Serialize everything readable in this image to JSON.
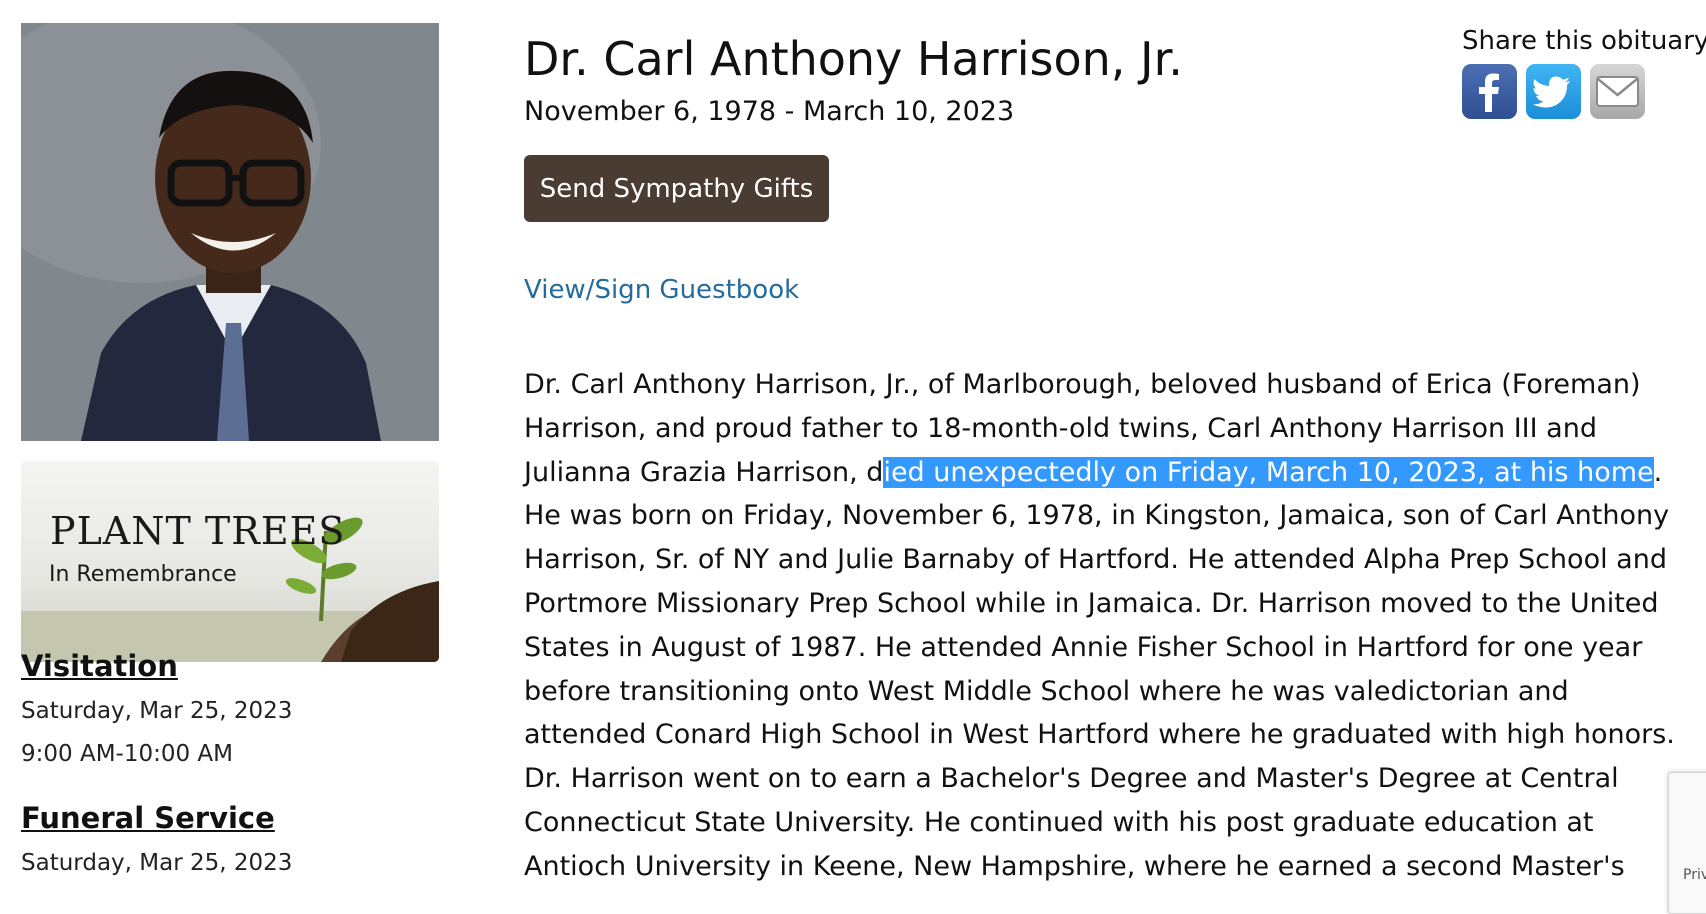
{
  "obituary": {
    "name": "Dr. Carl Anthony Harrison, Jr.",
    "dates": "November 6, 1978 - March 10, 2023",
    "photo_icon": "portrait-photo",
    "send_gifts_label": "Send Sympathy Gifts",
    "guestbook_link": "View/Sign Guestbook",
    "bio_before": "Dr. Carl Anthony Harrison, Jr., of Marlborough, beloved husband of Erica (Foreman) Harrison, and proud father to 18-month-old twins, Carl Anthony Harrison III and Julianna Grazia Harrison, d",
    "bio_highlight": "ied unexpectedly on Friday, March 10, 2023, at his home",
    "bio_after": ". He was born on Friday, November 6, 1978, in Kingston, Jamaica, son of Carl Anthony Harrison, Sr. of NY and Julie Barnaby of Hartford. He attended Alpha Prep School and Portmore Missionary Prep School while in Jamaica. Dr. Harrison moved to the United States in August of 1987. He attended Annie Fisher School in Hartford for one year before transitioning onto West Middle School where he was valedictorian and attended Conard High School in West Hartford where he graduated with high honors. Dr. Harrison went on to earn a Bachelor's Degree and Master's Degree at Central Connecticut State University. He continued with his post graduate education at Antioch University in Keene, New Hampshire, where he earned a second Master's"
  },
  "plant_trees": {
    "title": "PLANT TREES",
    "subtitle": "In Remembrance"
  },
  "events": [
    {
      "heading": "Visitation",
      "date": "Saturday, Mar 25, 2023",
      "time": "9:00 AM-10:00 AM"
    },
    {
      "heading": "Funeral Service",
      "date": "Saturday, Mar 25, 2023"
    }
  ],
  "share": {
    "label": "Share this obituary",
    "icons": [
      "facebook-icon",
      "twitter-icon",
      "email-icon"
    ]
  },
  "recaptcha": {
    "text": "Priv"
  },
  "colors": {
    "button_bg": "#4a3b33",
    "link": "#246c9e",
    "selection": "#3399ff"
  }
}
